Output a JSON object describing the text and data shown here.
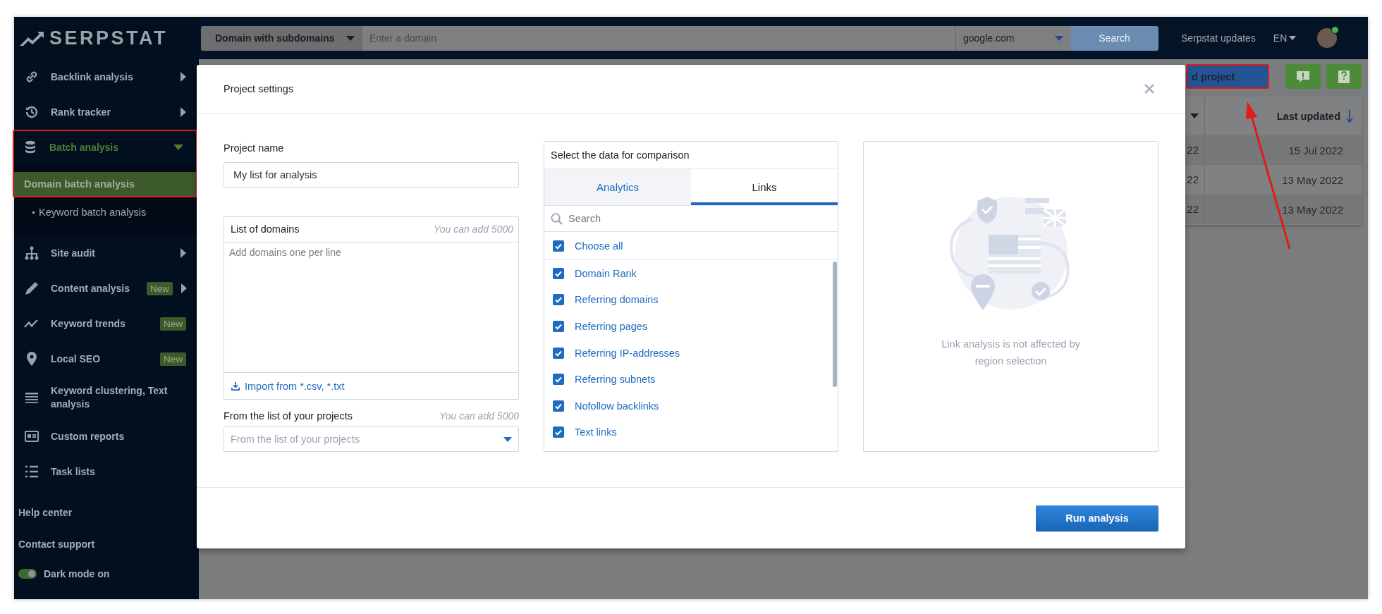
{
  "logo": {
    "text": "SERPSTAT"
  },
  "top_bar": {
    "search_type": "Domain with subdomains",
    "domain_field": {
      "placeholder": "Enter a domain"
    },
    "region": "google.com",
    "search_button": "Search",
    "updates_link": "Serpstat updates",
    "language": "EN"
  },
  "sidebar": {
    "items": [
      {
        "kind": "group",
        "label": "Backlink analysis",
        "selected": false,
        "expanded": false
      },
      {
        "kind": "group",
        "label": "Rank tracker",
        "selected": false,
        "expanded": false
      },
      {
        "kind": "group",
        "label": "Batch analysis",
        "selected": true,
        "expanded": true,
        "children": [
          {
            "label": "Domain batch analysis",
            "selected": true
          },
          {
            "label": "Keyword batch analysis",
            "selected": false
          }
        ]
      },
      {
        "kind": "group",
        "label": "Site audit",
        "selected": false,
        "expanded": false
      },
      {
        "kind": "group",
        "label": "Content analysis",
        "badge": "New",
        "selected": false,
        "expanded": false
      },
      {
        "kind": "link",
        "label": "Keyword trends",
        "badge": "New",
        "selected": false
      },
      {
        "kind": "link",
        "label": "Local SEO",
        "badge": "New",
        "selected": false
      },
      {
        "kind": "link",
        "label": "Keyword clustering, Text analysis",
        "selected": false
      },
      {
        "kind": "link",
        "label": "Custom reports",
        "selected": false
      },
      {
        "kind": "link",
        "label": "Task lists",
        "selected": false
      }
    ],
    "footer_links": [
      "Help center",
      "Contact support"
    ],
    "dark_mode": {
      "label": "Dark mode on",
      "on": true
    }
  },
  "background": {
    "add_project_button": "d project",
    "table": {
      "sort_column": "Last updated",
      "rows": [
        {
          "column_1": "22",
          "last_updated": "15 Jul 2022"
        },
        {
          "column_1": "22",
          "last_updated": "13 May 2022"
        },
        {
          "column_1": "22",
          "last_updated": "13 May 2022"
        }
      ]
    }
  },
  "modal": {
    "title": "Project settings",
    "project_name": {
      "label": "Project name",
      "value": "My list for analysis"
    },
    "domains": {
      "label": "List of domains",
      "hint": "You can add 5000",
      "placeholder": "Add domains one per line",
      "import_link": "Import from *.csv, *.txt"
    },
    "projects": {
      "label": "From the list of your projects",
      "hint": "You can add 5000",
      "placeholder": "From the list of your projects"
    },
    "comparison": {
      "title": "Select the data for comparison",
      "tabs": [
        {
          "label": "Analytics",
          "selected": false
        },
        {
          "label": "Links",
          "selected": true
        }
      ],
      "search": {
        "placeholder": "Search"
      },
      "choose_all": {
        "label": "Choose all",
        "checked": true
      },
      "options": [
        {
          "label": "Domain Rank",
          "checked": true
        },
        {
          "label": "Referring domains",
          "checked": true
        },
        {
          "label": "Referring pages",
          "checked": true
        },
        {
          "label": "Referring IP-addresses",
          "checked": true
        },
        {
          "label": "Referring subnets",
          "checked": true
        },
        {
          "label": "Nofollow backlinks",
          "checked": true
        },
        {
          "label": "Text links",
          "checked": true
        }
      ]
    },
    "note": "Link analysis is not affected by region selection",
    "run_button": "Run analysis"
  }
}
